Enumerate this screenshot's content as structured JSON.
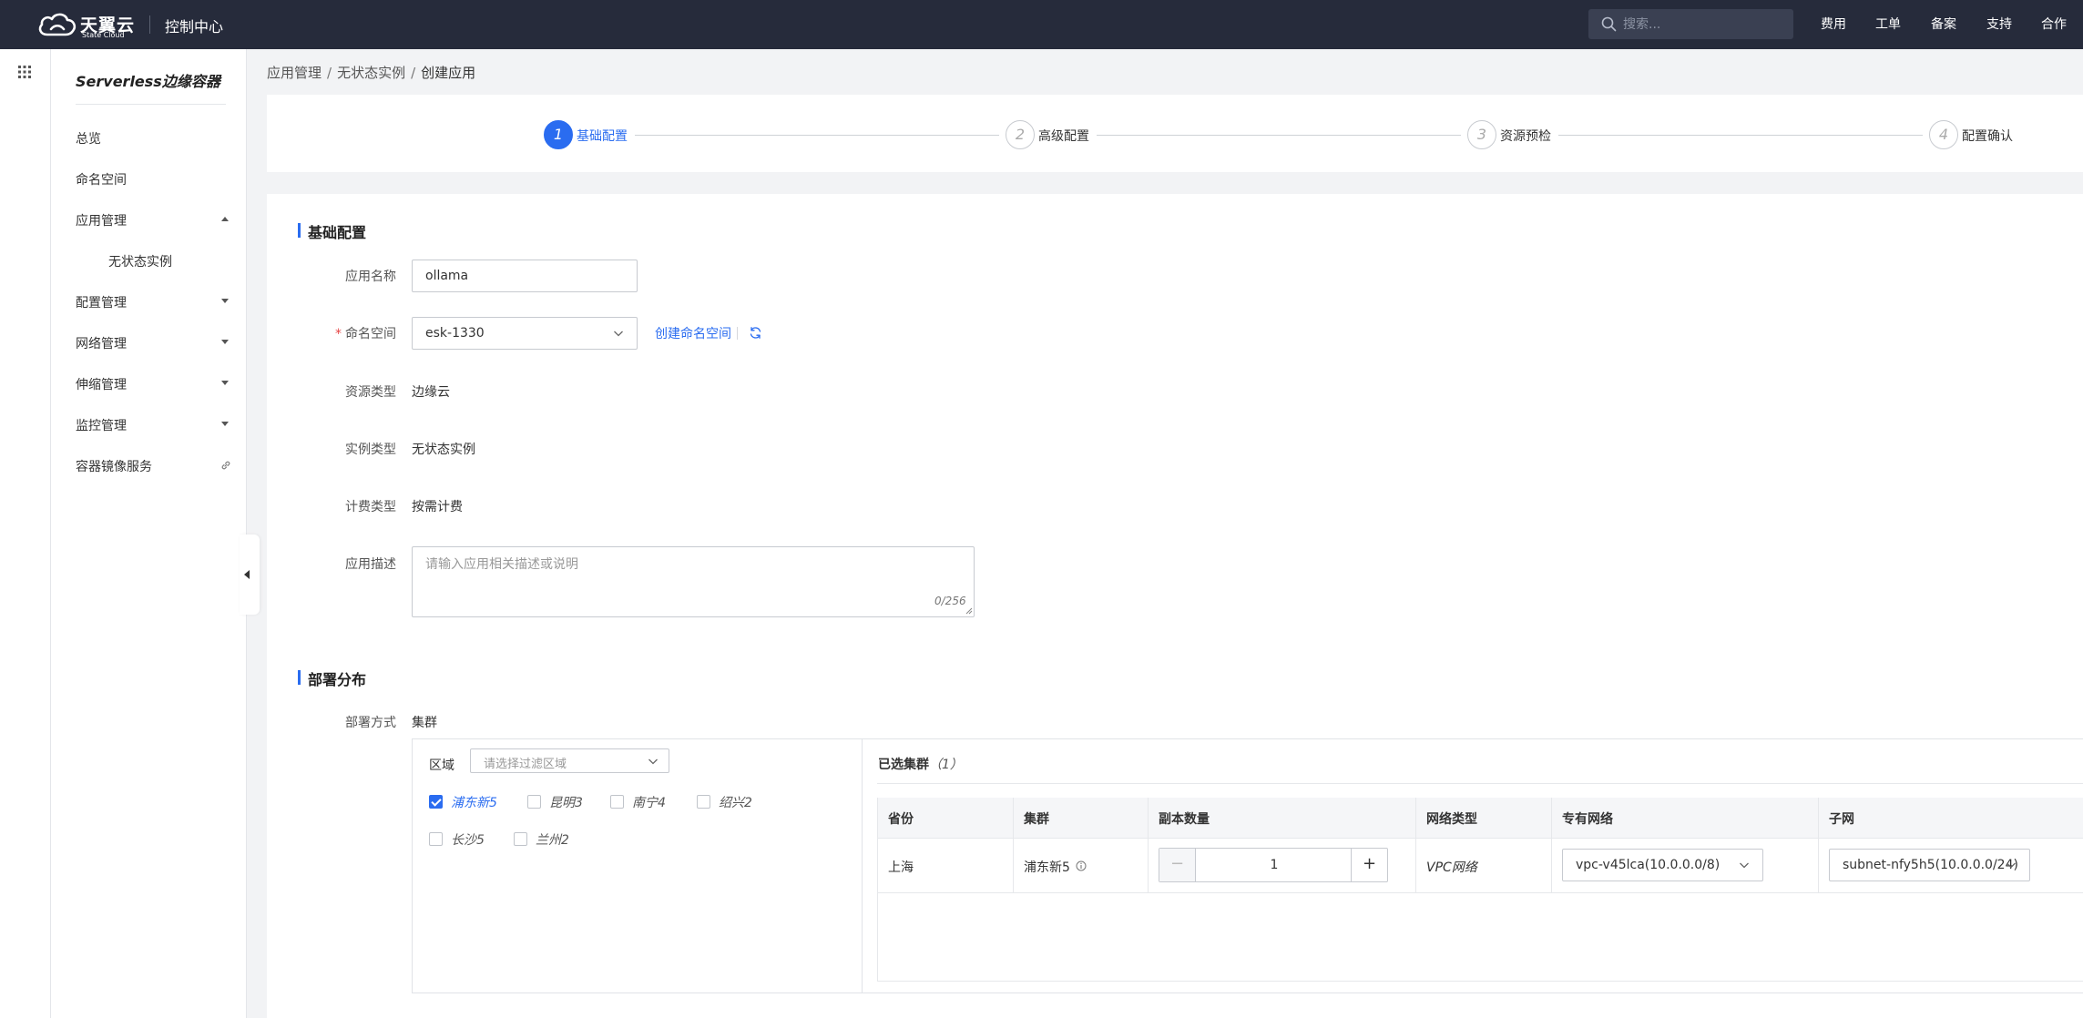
{
  "brand": {
    "name_cn": "天翼云",
    "name_en": "State Cloud",
    "console_title": "控制中心"
  },
  "header": {
    "search_placeholder": "搜索...",
    "nav": [
      "费用",
      "工单",
      "备案",
      "支持",
      "合作"
    ]
  },
  "sidebar": {
    "product_title": "Serverless边缘容器",
    "items": [
      {
        "label": "总览"
      },
      {
        "label": "命名空间"
      },
      {
        "label": "应用管理",
        "expanded": true
      },
      {
        "label": "无状态实例"
      },
      {
        "label": "配置管理"
      },
      {
        "label": "网络管理"
      },
      {
        "label": "伸缩管理"
      },
      {
        "label": "监控管理"
      },
      {
        "label": "容器镜像服务"
      }
    ]
  },
  "breadcrumb": [
    "应用管理",
    "无状态实例",
    "创建应用"
  ],
  "steps": [
    {
      "num": "1",
      "label": "基础配置",
      "active": true
    },
    {
      "num": "2",
      "label": "高级配置",
      "active": false
    },
    {
      "num": "3",
      "label": "资源预检",
      "active": false
    },
    {
      "num": "4",
      "label": "配置确认",
      "active": false
    }
  ],
  "basic": {
    "title": "基础配置",
    "app_name_label": "应用名称",
    "app_name_value": "ollama",
    "namespace_label": "命名空间",
    "namespace_value": "esk-1330",
    "create_namespace_link": "创建命名空间",
    "resource_type_label": "资源类型",
    "resource_type_value": "边缘云",
    "instance_type_label": "实例类型",
    "instance_type_value": "无状态实例",
    "billing_label": "计费类型",
    "billing_value": "按需计费",
    "desc_label": "应用描述",
    "desc_placeholder": "请输入应用相关描述或说明",
    "desc_count": "0/256"
  },
  "deploy": {
    "title": "部署分布",
    "mode_label": "部署方式",
    "mode_value": "集群",
    "region_label": "区域",
    "region_placeholder": "请选择过滤区域",
    "regions": [
      {
        "label": "浦东新5",
        "checked": true
      },
      {
        "label": "昆明3",
        "checked": false
      },
      {
        "label": "南宁4",
        "checked": false
      },
      {
        "label": "绍兴2",
        "checked": false
      },
      {
        "label": "长沙5",
        "checked": false
      },
      {
        "label": "兰州2",
        "checked": false
      }
    ],
    "selected_title": "已选集群",
    "selected_count": "（1）",
    "columns": [
      "省份",
      "集群",
      "副本数量",
      "网络类型",
      "专有网络",
      "子网"
    ],
    "row": {
      "province": "上海",
      "cluster": "浦东新5",
      "replicas": "1",
      "network_type": "VPC网络",
      "vpc": "vpc-v45lca(10.0.0.0/8)",
      "subnet": "subnet-nfy5h5(10.0.0.0/24)"
    }
  },
  "colors": {
    "topbar": "#262b3b",
    "accent": "#2a6cf0",
    "required": "#e54545"
  }
}
